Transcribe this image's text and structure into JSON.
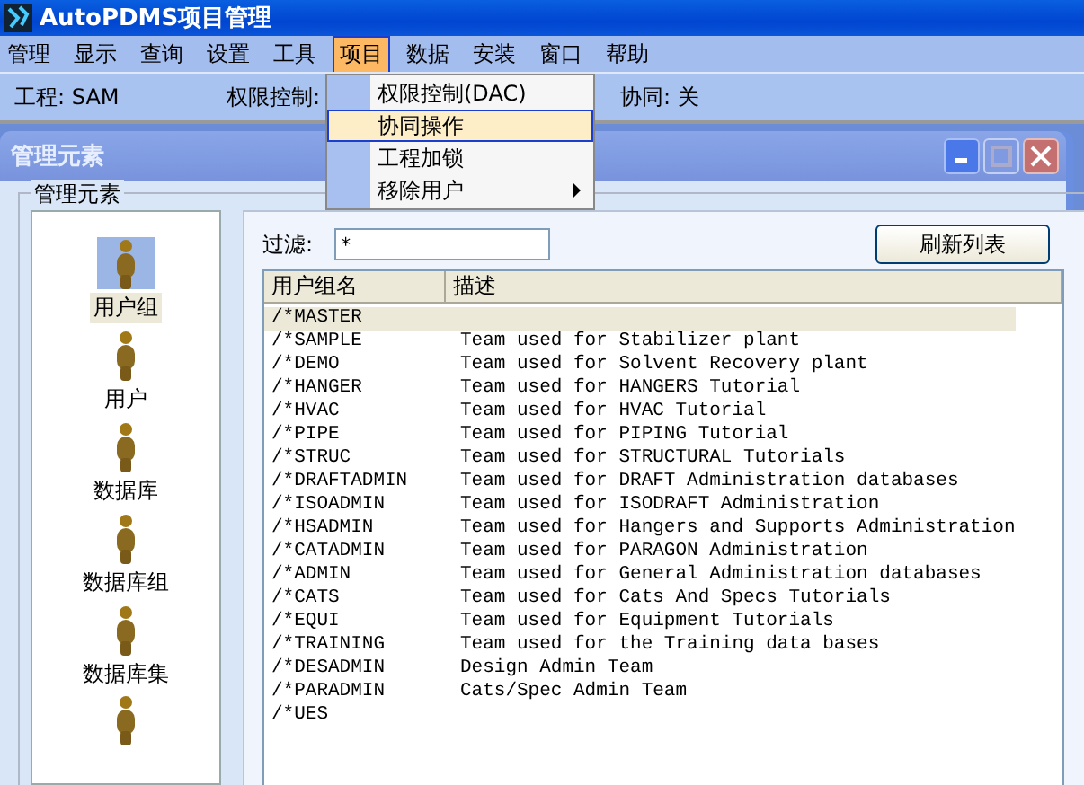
{
  "window": {
    "title": "AutoPDMS项目管理"
  },
  "menu": [
    {
      "label": "管理",
      "selected": false
    },
    {
      "label": "显示",
      "selected": false
    },
    {
      "label": "查询",
      "selected": false
    },
    {
      "label": "设置",
      "selected": false
    },
    {
      "label": "工具",
      "selected": false
    },
    {
      "label": "项目",
      "selected": true
    },
    {
      "label": "数据",
      "selected": false
    },
    {
      "label": "安装",
      "selected": false
    },
    {
      "label": "窗口",
      "selected": false
    },
    {
      "label": "帮助",
      "selected": false
    }
  ],
  "dropdown": [
    {
      "label": "权限控制(DAC)",
      "selected": false,
      "submenu": false
    },
    {
      "label": "协同操作",
      "selected": true,
      "submenu": false
    },
    {
      "label": "工程加锁",
      "selected": false,
      "submenu": false
    },
    {
      "label": "移除用户",
      "selected": false,
      "submenu": true
    }
  ],
  "info_bar": [
    {
      "label": "工程:",
      "value": "SAM"
    },
    {
      "label": "权限控制:"
    },
    {
      "label": "协同:",
      "value": "关"
    }
  ],
  "child_window": {
    "title": "管理元素"
  },
  "group": {
    "title": "管理元素",
    "elements": [
      {
        "label": "用户组",
        "selected": true
      },
      {
        "label": "用户",
        "selected": false
      },
      {
        "label": "数据库",
        "selected": false
      },
      {
        "label": "数据库组",
        "selected": false
      },
      {
        "label": "数据库集",
        "selected": false
      }
    ]
  },
  "filter": {
    "label": "过滤:",
    "value": "*"
  },
  "refresh_button": "刷新列表",
  "table": {
    "columns": [
      "用户组名",
      "描述"
    ],
    "rows": [
      {
        "name": "/*MASTER",
        "selected": true
      },
      {
        "name": "/*SAMPLE",
        "description": "Team used for Stabilizer plant",
        "selected": false
      },
      {
        "name": "/*DEMO",
        "description": "Team used for Solvent Recovery plant",
        "selected": false
      },
      {
        "name": "/*HANGER",
        "description": "Team used for HANGERS Tutorial",
        "selected": false
      },
      {
        "name": "/*HVAC",
        "description": "Team used for HVAC Tutorial",
        "selected": false
      },
      {
        "name": "/*PIPE",
        "description": "Team used for PIPING Tutorial",
        "selected": false
      },
      {
        "name": "/*STRUC",
        "description": "Team used for STRUCTURAL Tutorials",
        "selected": false
      },
      {
        "name": "/*DRAFTADMIN",
        "description": "Team used for DRAFT Administration databases",
        "selected": false
      },
      {
        "name": "/*ISOADMIN",
        "description": "Team used for ISODRAFT Administration",
        "selected": false
      },
      {
        "name": "/*HSADMIN",
        "description": "Team used for Hangers and Supports Administration",
        "selected": false
      },
      {
        "name": "/*CATADMIN",
        "description": "Team used for PARAGON Administration",
        "selected": false
      },
      {
        "name": "/*ADMIN",
        "description": "Team used for General Administration databases",
        "selected": false
      },
      {
        "name": "/*CATS",
        "description": "Team used for Cats And Specs Tutorials",
        "selected": false
      },
      {
        "name": "/*EQUI",
        "description": "Team used for Equipment Tutorials",
        "selected": false
      },
      {
        "name": "/*TRAINING",
        "description": "Team used for the Training data bases",
        "selected": false
      },
      {
        "name": "/*DESADMIN",
        "description": "Design Admin Team",
        "selected": false
      },
      {
        "name": "/*PARADMIN",
        "description": "Cats/Spec Admin Team",
        "selected": false
      },
      {
        "name": "/*UES",
        "selected": false
      }
    ]
  }
}
